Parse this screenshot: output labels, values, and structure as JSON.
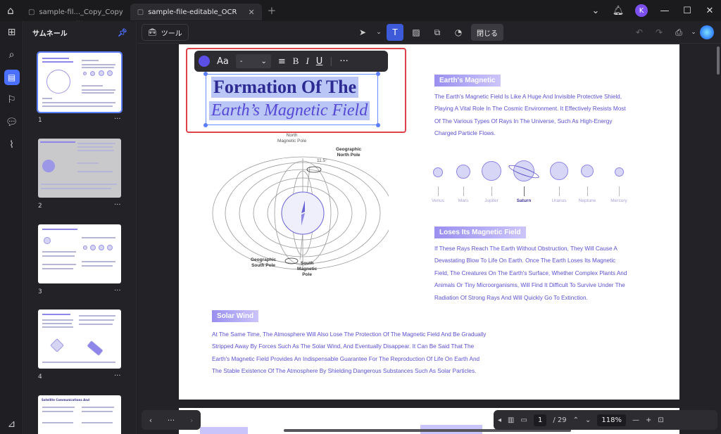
{
  "tabs": [
    {
      "label": "sample-fil..._Copy_Copy",
      "active": false
    },
    {
      "label": "sample-file-editable_OCR",
      "active": true
    }
  ],
  "user_initial": "K",
  "sidebar": {
    "header": "サムネール",
    "thumbnails": [
      {
        "page": "1"
      },
      {
        "page": "2"
      },
      {
        "page": "3"
      },
      {
        "page": "4"
      }
    ],
    "thumb5_title": "Satellite Communications And"
  },
  "toolbar": {
    "tools_label": "ツール",
    "close_label": "閉じる"
  },
  "text_toolbar": {
    "font_label": "Aa",
    "size_value": "-",
    "more": "···"
  },
  "document": {
    "title_line1": "Formation Of The",
    "title_line2": "Earth’s Magnetic Field",
    "earth_magnetic": {
      "tag": "Earth's Magnetic",
      "lines": [
        "The Earth's Magnetic Field Is Like A Huge And Invisible Protective Shield,",
        "Playing A Vital Role In The Cosmic Environment. It Effectively Resists Most",
        "Of The Various Types Of Rays In The Universe, Such As High-Energy",
        "Charged Particle Flows."
      ]
    },
    "planets": [
      "Venus",
      "Mars",
      "Jupiter",
      "Saturn",
      "Uranus",
      "Neptune",
      "Mercury"
    ],
    "loses": {
      "tag": "Loses Its Magnetic Field",
      "lines": [
        "If These Rays Reach The Earth Without Obstruction, They Will Cause A",
        "Devastating Blow To Life On Earth. Once The Earth Loses Its Magnetic",
        "Field, The Creatures On The Earth's Surface, Whether Complex Plants And",
        "Animals Or Tiny Microorganisms, Will Find It Difficult To Survive Under The",
        "Radiation Of Strong Rays And Will Quickly Go To Extinction."
      ]
    },
    "solar": {
      "tag": "Solar Wind",
      "lines": [
        "At The Same Time, The Atmosphere Will Also Lose The Protection Of The Magnetic Field And Be Gradually",
        "Stripped Away By Forces Such As The Solar Wind, And Eventually Disappear. It Can Be Said That The",
        "Earth's Magnetic Field Provides An Indispensable Guarantee For The Reproduction Of Life On Earth And",
        "The Stable Existence Of The Atmosphere By Shielding Dangerous Substances Such As Solar Particles."
      ]
    },
    "diagram_labels": {
      "north_magnetic": "North\nMagnetic Pole",
      "geo_north": "Geographic\nNorth Pole",
      "geo_south": "Geographic\nSouth Pole",
      "south_magnetic": "South\nMagnetic\nPole",
      "angle": "11.5°"
    }
  },
  "pager": {
    "current": "1",
    "total": "/ 29",
    "zoom": "118%"
  }
}
